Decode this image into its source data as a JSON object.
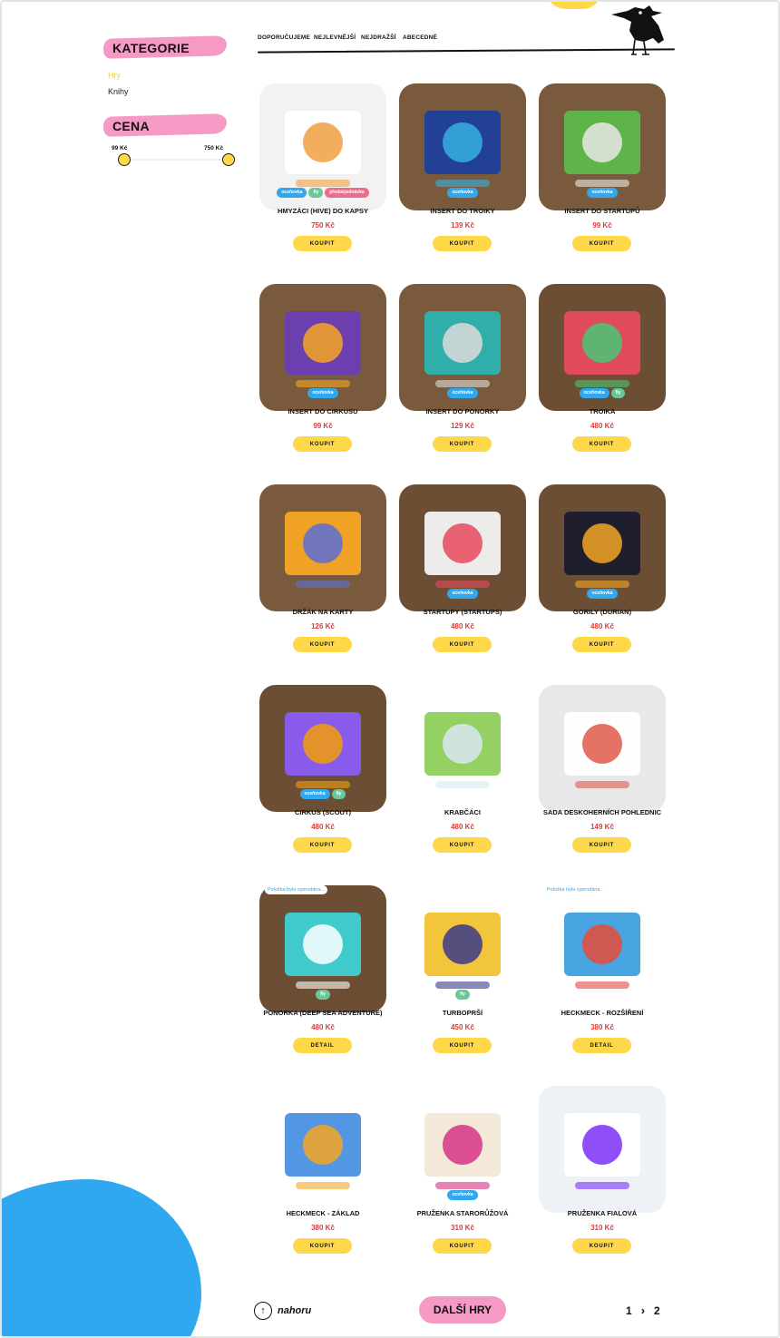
{
  "sidebar": {
    "categories_title": "KATEGORIE",
    "categories": [
      {
        "label": "Hry",
        "active": true
      },
      {
        "label": "Knihy",
        "active": false
      }
    ],
    "price_title": "CENA",
    "price_min_label": "99 Kč",
    "price_max_label": "750 Kč"
  },
  "sort": {
    "recommended": "DOPORUČUJEME",
    "cheapest": "NEJLEVNĚJŠÍ",
    "most_expensive": "NEJDRAŽŠÍ",
    "alphabetical": "ABECEDNÉ"
  },
  "products": [
    {
      "name": "HMYZÁCI (HIVE) DO KAPSY",
      "price": "750 Kč",
      "button": "KOUPIT",
      "badges": [
        {
          "text": "oceňovka",
          "color": "blue"
        },
        {
          "text": "fiy",
          "color": "green"
        },
        {
          "text": "předobjednávka",
          "color": "pink"
        }
      ],
      "sold_note": ""
    },
    {
      "name": "INSERT DO TROIKY",
      "price": "139 Kč",
      "button": "KOUPIT",
      "badges": [
        {
          "text": "oceňovka",
          "color": "blue"
        }
      ],
      "sold_note": ""
    },
    {
      "name": "INSERT DO STARTUPŮ",
      "price": "99 Kč",
      "button": "KOUPIT",
      "badges": [
        {
          "text": "oceňovka",
          "color": "blue"
        }
      ],
      "sold_note": ""
    },
    {
      "name": "INSERT DO CIRKUSU",
      "price": "99 Kč",
      "button": "KOUPIT",
      "badges": [
        {
          "text": "oceňovka",
          "color": "blue"
        }
      ],
      "sold_note": ""
    },
    {
      "name": "INSERT DO PONORKY",
      "price": "129 Kč",
      "button": "KOUPIT",
      "badges": [
        {
          "text": "oceňovka",
          "color": "blue"
        }
      ],
      "sold_note": ""
    },
    {
      "name": "TROIKA",
      "price": "480 Kč",
      "button": "KOUPIT",
      "badges": [
        {
          "text": "oceňovka",
          "color": "blue"
        },
        {
          "text": "fiy",
          "color": "green"
        }
      ],
      "sold_note": ""
    },
    {
      "name": "DRŽÁK NA KARTY",
      "price": "126 Kč",
      "button": "KOUPIT",
      "badges": [],
      "sold_note": ""
    },
    {
      "name": "STARTUPY (STARTUPS)",
      "price": "480 Kč",
      "button": "KOUPIT",
      "badges": [
        {
          "text": "oceňovka",
          "color": "blue"
        }
      ],
      "sold_note": ""
    },
    {
      "name": "GORILY (DURIAN)",
      "price": "480 Kč",
      "button": "KOUPIT",
      "badges": [
        {
          "text": "oceňovka",
          "color": "blue"
        }
      ],
      "sold_note": ""
    },
    {
      "name": "CIRKUS (SCOUT)",
      "price": "480 Kč",
      "button": "KOUPIT",
      "badges": [
        {
          "text": "oceňovka",
          "color": "blue"
        },
        {
          "text": "fiy",
          "color": "green"
        }
      ],
      "sold_note": ""
    },
    {
      "name": "KRABČÁCI",
      "price": "480 Kč",
      "button": "KOUPIT",
      "badges": [],
      "sold_note": ""
    },
    {
      "name": "SADA DESKOHERNÍCH POHLEDNIC",
      "price": "149 Kč",
      "button": "KOUPIT",
      "badges": [],
      "sold_note": ""
    },
    {
      "name": "PONORKA (DEEP SEA ADVENTURE)",
      "price": "480 Kč",
      "button": "DETAIL",
      "badges": [
        {
          "text": "fiy",
          "color": "green"
        }
      ],
      "sold_note": "Položka byla vyprodána..."
    },
    {
      "name": "TURBOPRŠÍ",
      "price": "450 Kč",
      "button": "KOUPIT",
      "badges": [
        {
          "text": "fiy",
          "color": "green"
        }
      ],
      "sold_note": ""
    },
    {
      "name": "HECKMECK - ROZŠÍŘENÍ",
      "price": "380 Kč",
      "button": "DETAIL",
      "badges": [],
      "sold_note": "Položka byla vyprodána..."
    },
    {
      "name": "HECKMECK - ZÁKLAD",
      "price": "380 Kč",
      "button": "KOUPIT",
      "badges": [],
      "sold_note": ""
    },
    {
      "name": "PRUŽENKA STARORŮŽOVÁ",
      "price": "310 Kč",
      "button": "KOUPIT",
      "badges": [
        {
          "text": "oceňovka",
          "color": "blue"
        }
      ],
      "sold_note": ""
    },
    {
      "name": "PRUŽENKA FIALOVÁ",
      "price": "310 Kč",
      "button": "KOUPIT",
      "badges": [],
      "sold_note": ""
    }
  ],
  "footer": {
    "back_to_top": "nahoru",
    "more_games": "DALŠÍ HRY",
    "page_current": "1",
    "page_next_arrow": "›",
    "page_last": "2"
  },
  "colors": {
    "accent_yellow": "#ffd84a",
    "accent_pink": "#f59ac4",
    "accent_blue": "#2fa8ef",
    "price_red": "#e03a3a"
  }
}
